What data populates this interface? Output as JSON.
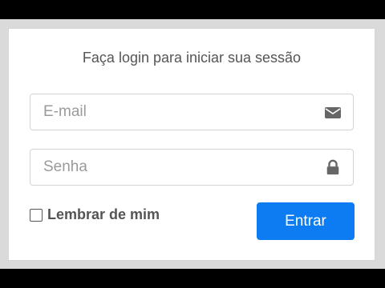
{
  "login": {
    "title": "Faça login para iniciar sua sessão",
    "email": {
      "placeholder": "E-mail",
      "value": "",
      "icon": "envelope-icon"
    },
    "password": {
      "placeholder": "Senha",
      "value": "",
      "icon": "lock-icon"
    },
    "remember": {
      "label": "Lembrar de mim",
      "checked": false
    },
    "submit_label": "Entrar"
  },
  "colors": {
    "primary": "#0d7cf2",
    "text": "#555555",
    "border": "#cfd4d9",
    "background": "#dadada"
  }
}
